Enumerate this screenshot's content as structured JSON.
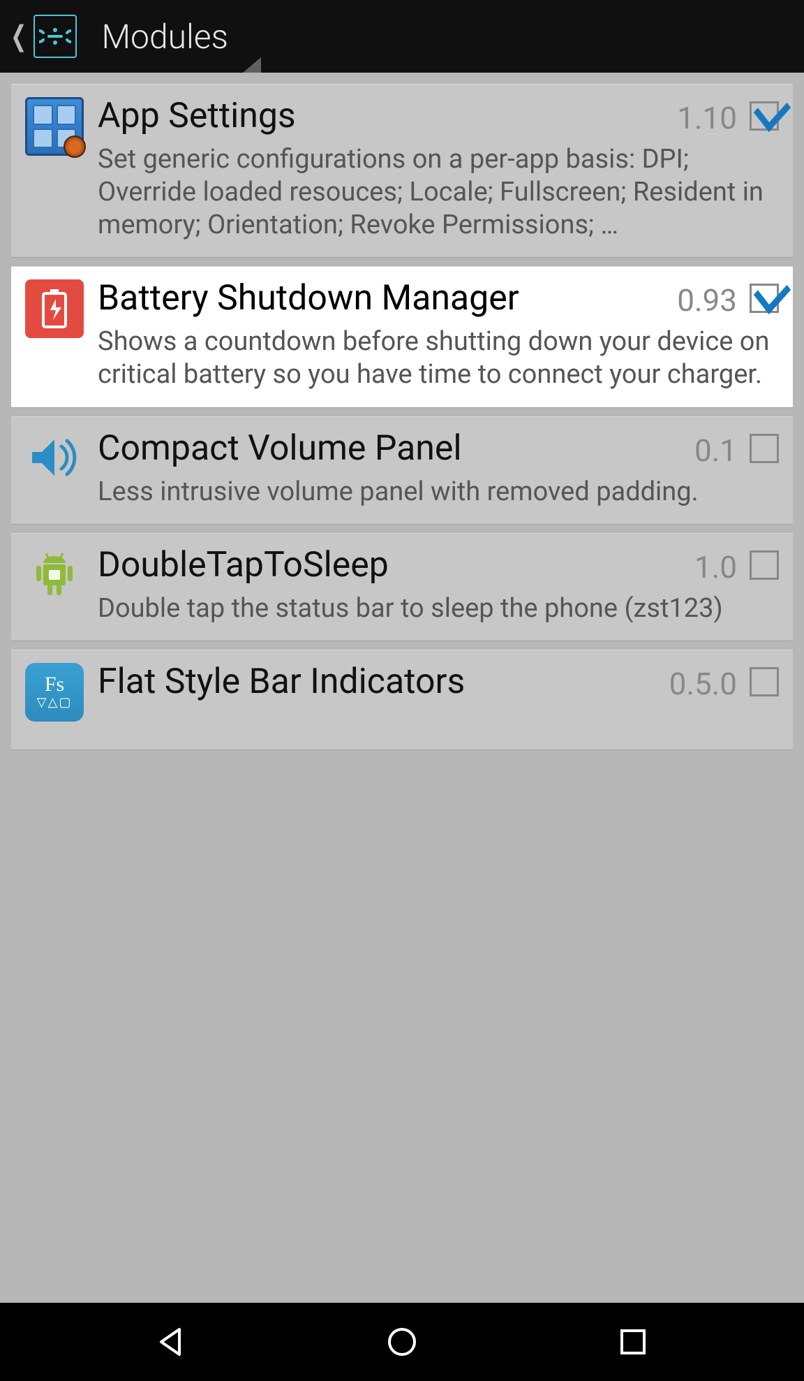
{
  "header": {
    "title": "Modules"
  },
  "modules": [
    {
      "id": "app-settings",
      "title": "App Settings",
      "version": "1.10",
      "checked": true,
      "highlight": false,
      "desc": "Set generic configurations on a per-app basis: DPI; Override loaded resouces; Locale; Fullscreen; Resident in memory; Orientation; Revoke Permissions; …",
      "icon": "grid-gear"
    },
    {
      "id": "battery-shutdown",
      "title": "Battery Shutdown Manager",
      "version": "0.93",
      "checked": true,
      "highlight": true,
      "desc": "Shows a countdown before shutting down your device on critical battery so you have time to connect your charger.",
      "icon": "battery"
    },
    {
      "id": "compact-volume",
      "title": "Compact Volume Panel",
      "version": "0.1",
      "checked": false,
      "highlight": false,
      "desc": "Less intrusive volume panel with removed padding.",
      "icon": "volume"
    },
    {
      "id": "doubletap",
      "title": "DoubleTapToSleep",
      "version": "1.0",
      "checked": false,
      "highlight": false,
      "desc": "Double tap the status bar to sleep the phone (zst123)",
      "icon": "android"
    },
    {
      "id": "flatstyle",
      "title": "Flat Style Bar Indicators",
      "version": "0.5.0",
      "checked": false,
      "highlight": false,
      "desc": "",
      "icon": "fs"
    }
  ]
}
